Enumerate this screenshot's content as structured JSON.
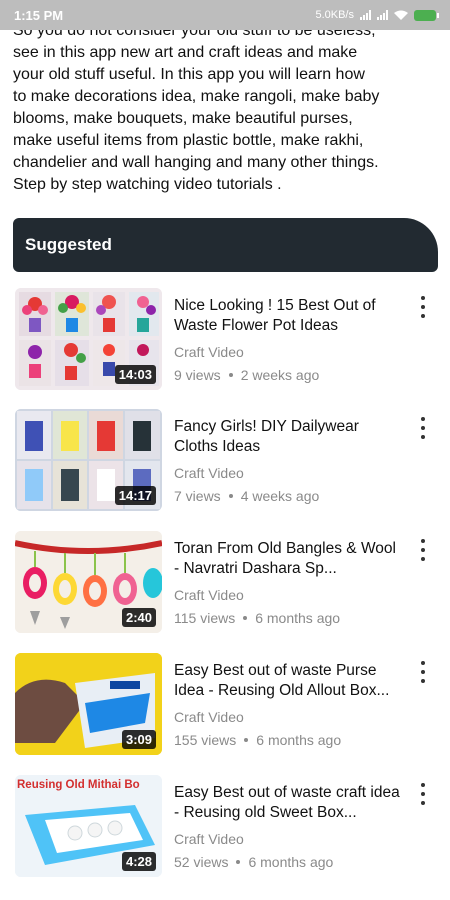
{
  "status": {
    "time": "1:15 PM",
    "speed": "5.0KB/s"
  },
  "description": "So you do not consider your old stuff to be useless,\nsee in this app new art and craft ideas and make\nyour old stuff useful. In this app you will learn how\nto make decorations idea, make rangoli, make baby\nblooms, make bouquets, make beautiful purses,\nmake useful items from plastic bottle, make rakhi,\nchandelier and wall hanging and many other things.\nStep by step watching video tutorials .",
  "suggested_label": "Suggested",
  "videos": [
    {
      "title": "Nice Looking ! 15 Best Out of Waste Flower Pot Ideas",
      "channel": "Craft Video",
      "views": "9 views",
      "age": "2 weeks ago",
      "duration": "14:03"
    },
    {
      "title": "Fancy Girls! DIY Dailywear Cloths Ideas",
      "channel": "Craft Video",
      "views": "7 views",
      "age": "4 weeks ago",
      "duration": "14:17"
    },
    {
      "title": "Toran From Old Bangles & Wool - Navratri Dashara Sp...",
      "channel": "Craft Video",
      "views": "115 views",
      "age": "6 months ago",
      "duration": "2:40"
    },
    {
      "title": "Easy Best out of waste Purse Idea - Reusing Old Allout Box...",
      "channel": "Craft Video",
      "views": "155 views",
      "age": "6 months ago",
      "duration": "3:09"
    },
    {
      "title": "Easy Best out of waste craft idea - Reusing old Sweet Box...",
      "channel": "Craft Video",
      "views": "52 views",
      "age": "6 months ago",
      "duration": "4:28"
    }
  ],
  "thumb5_caption": "Reusing Old Mithai Bo",
  "colors": {
    "header_bg": "#222a31",
    "status_bg": "#bdbdbd",
    "battery": "#4caf50"
  },
  "icons": [
    "signal-icon",
    "wifi-icon",
    "battery-icon",
    "more-vert-icon"
  ]
}
